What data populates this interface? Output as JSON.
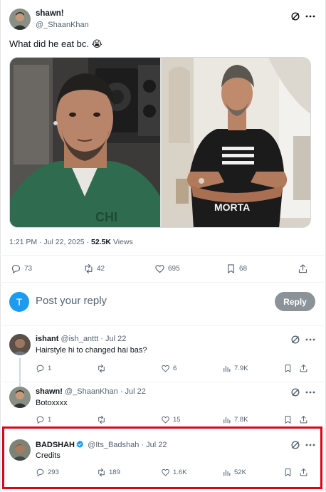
{
  "main_tweet": {
    "author_name": "shawn!",
    "author_handle": "@_ShaanKhan",
    "text": "What did he eat bc. 😭",
    "time": "1:21 PM · Jul 22, 2025",
    "dot": " · ",
    "views_count": "52.5K",
    "views_label": " Views",
    "actions": {
      "replies": "73",
      "reposts": "42",
      "likes": "695",
      "bookmarks": "68"
    }
  },
  "compose": {
    "avatar_letter": "T",
    "placeholder": "Post your reply",
    "button_label": "Reply"
  },
  "replies": [
    {
      "name": "ishant",
      "handle": "@ish_anttt",
      "date": "· Jul 22",
      "text": "Hairstyle hi to changed hai bas?",
      "actions": {
        "replies": "1",
        "reposts": "",
        "likes": "6",
        "views": "7.9K"
      }
    },
    {
      "name": "shawn!",
      "handle": "@_ShaanKhan",
      "date": "· Jul 22",
      "text": "Botoxxxx",
      "actions": {
        "replies": "1",
        "reposts": "",
        "likes": "15",
        "views": "7.8K"
      }
    },
    {
      "name": "BADSHAH",
      "handle": "@Its_Badshah",
      "date": "· Jul 22",
      "text": "Credits",
      "verified": true,
      "actions": {
        "replies": "293",
        "reposts": "189",
        "likes": "1.6K",
        "views": "52K"
      }
    }
  ],
  "colors": {
    "accent": "#1d9bf0",
    "highlight": "#e0001b",
    "secondary_text": "#536471",
    "reply_button": "#8b9399"
  }
}
